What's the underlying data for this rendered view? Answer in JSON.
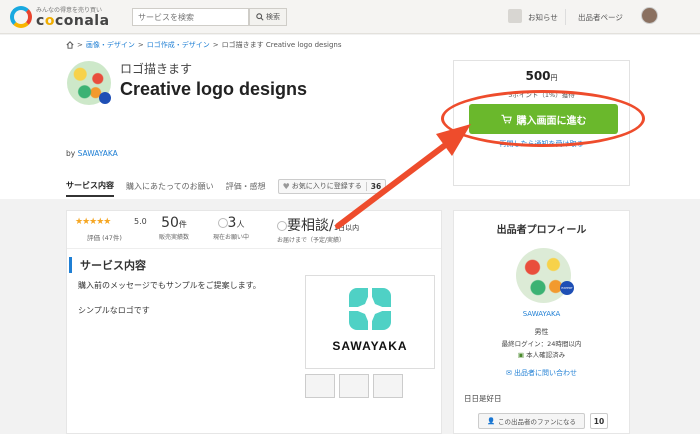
{
  "header": {
    "logo_tagline": "みんなの得意を売り買い",
    "logo_text_before": "c",
    "logo_text_o": "o",
    "logo_text_after": "conala",
    "search_placeholder": "サービスを検索",
    "search_button": "検索",
    "notice_label": "お知らせ",
    "seller_page_label": "出品者ページ"
  },
  "breadcrumb": {
    "items": [
      "画像・デザイン",
      "ロゴ作成・デザイン",
      "ロゴ描きます Creative logo designs"
    ],
    "separator": ">"
  },
  "service": {
    "subtitle": "ロゴ描きます",
    "title": "Creative logo designs",
    "by_prefix": "by",
    "seller_name": "SAWAYAKA"
  },
  "price_box": {
    "price": "500",
    "currency": "円",
    "points": "5ポイント（1%）獲得",
    "buy_button": "購入画面に進む",
    "notify_link": "再開したら通知を受け取る"
  },
  "tabs": {
    "service_content": "サービス内容",
    "before_purchase": "購入にあたってのお願い",
    "reviews": "評価・感想",
    "favorite_label": "お気に入りに登録する",
    "favorite_count": "36"
  },
  "stats": {
    "stars": "★★★★★",
    "score": "5.0",
    "rating_count": "評価 (47件)",
    "sales_value": "50",
    "sales_unit": "件",
    "sales_label": "販売実績数",
    "current_value": "3",
    "current_unit": "人",
    "current_label": "現在お願い中",
    "delivery_value": "要相談",
    "delivery_suffix": "/",
    "delivery_label": "お届けまで（予定/実績）",
    "delivery_actual": "1日以内"
  },
  "content": {
    "section_title": "サービス内容",
    "description_1": "購入前のメッセージでもサンプルをご提案します。",
    "description_2": "シンプルなロゴです",
    "hero_text": "SAWAYAKA"
  },
  "seller": {
    "panel_title": "出品者プロフィール",
    "badge": "EXPERT",
    "name": "SAWAYAKA",
    "gender": "男性",
    "last_login": "最終ログイン：24時間以内",
    "verified": "本人確認済み",
    "contact_link": "出品者に問い合わせ",
    "schedule": "日日是好日",
    "fan_button": "この出品者のファンになる",
    "fan_count": "10"
  },
  "colors": {
    "buy_green": "#6ab82c",
    "link_blue": "#1f7fd4",
    "annotation_red": "#ee4c2c",
    "star_orange": "#f5a623"
  }
}
